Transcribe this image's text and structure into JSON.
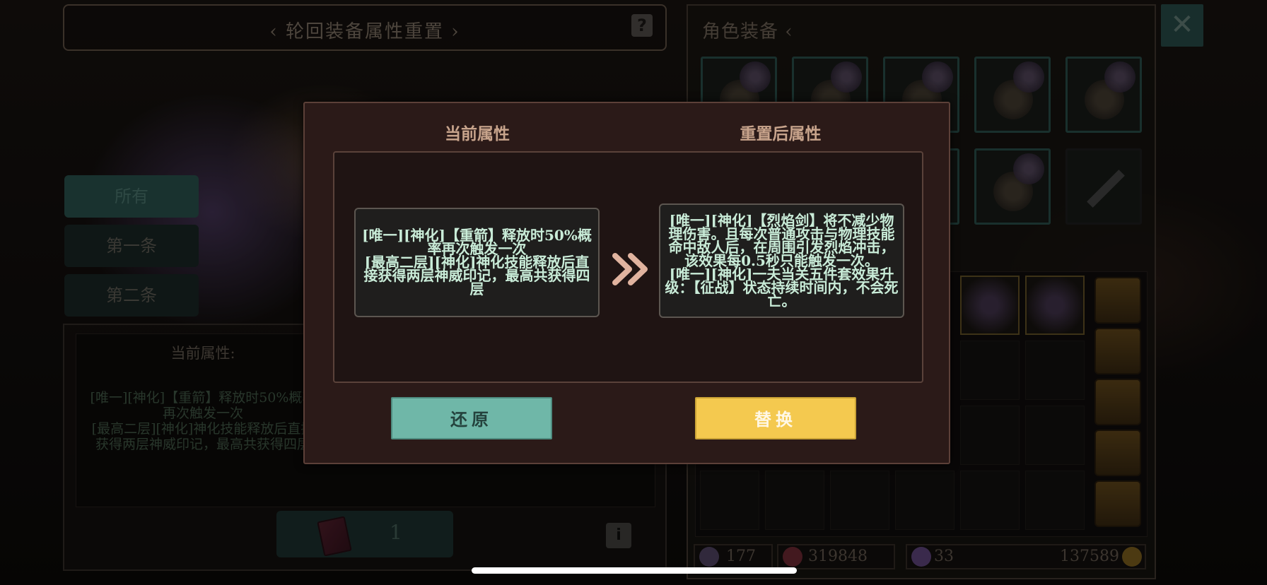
{
  "window": {
    "title": "轮回装备属性重置",
    "help_icon": "question-icon"
  },
  "filters": [
    {
      "label": "所有",
      "selected": true
    },
    {
      "label": "第一条",
      "selected": false
    },
    {
      "label": "第二条",
      "selected": false
    }
  ],
  "left_panel": {
    "current_label": "当前属性:",
    "current_desc": "[唯一][神化]【重箭】释放时50%概率再次触发一次\n[最高二层][神化]神化技能释放后直接获得两层神威印记，最高共获得四层",
    "item_count": "1",
    "info_icon": "i"
  },
  "right_panel": {
    "title": "角色装备",
    "close_icon": "✕",
    "stats": {
      "weapon_level": "177",
      "power": "319848",
      "crystal": "33",
      "gold": "137589"
    }
  },
  "modal": {
    "current_title": "当前属性",
    "reset_title": "重置后属性",
    "current_text": "[唯一][神化]【重箭】释放时50%概率再次触发一次\n[最高二层][神化]神化技能释放后直接获得两层神威印记，最高共获得四层",
    "reset_text": "[唯一][神化]【烈焰剑】将不减少物理伤害。且每次普通攻击与物理技能命中敌人后，在周围引发烈焰冲击，该效果每0.5秒只能触发一次。\n[唯一][神化]一夫当关五件套效果升级：【征战】状态持续时间内，不会死亡。",
    "restore_label": "还原",
    "replace_label": "替换"
  },
  "colors": {
    "restore_button": "#6fb7a8",
    "replace_button": "#f4c94f",
    "modal_bg": "#2b1a18",
    "attr_text": "#c9ecd8"
  }
}
